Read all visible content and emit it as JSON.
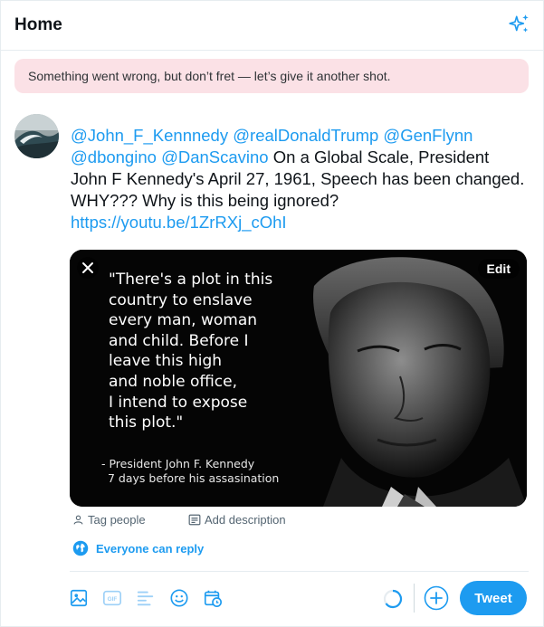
{
  "header": {
    "title": "Home",
    "sparkle_icon": "sparkle-icon"
  },
  "error": {
    "message": "Something went wrong, but don’t fret — let’s give it another shot."
  },
  "compose": {
    "mentions": [
      "@John_F_Kennnedy",
      "@realDonaldTrump",
      "@GenFlynn",
      "@dbongino",
      "@DanScavino"
    ],
    "body": "On a Global Scale, President John F Kennedy's April 27, 1961, Speech has been changed. WHY??? Why is this being ignored?",
    "link": "https://youtu.be/1ZrRXj_cOhI"
  },
  "media": {
    "edit_label": "Edit",
    "quote_lines": [
      "\"There's a plot in this",
      "country to enslave",
      "every man, woman",
      "and child. Before I",
      "leave this high",
      "and noble office,",
      "I intend to expose",
      "this plot.\""
    ],
    "attribution_lines": [
      "- President John F. Kennedy",
      "7 days before his assasination"
    ]
  },
  "meta": {
    "tag_people": "Tag people",
    "add_description": "Add description"
  },
  "reply_setting": "Everyone can reply",
  "toolbar": {
    "icons": [
      "image-icon",
      "gif-icon",
      "poll-icon",
      "emoji-icon",
      "schedule-icon"
    ],
    "gif_label": "GIF",
    "tweet_label": "Tweet"
  },
  "colors": {
    "accent": "#1d9bf0",
    "error_bg": "#fbe1e6",
    "text": "#0f1419",
    "muted": "#536471"
  }
}
